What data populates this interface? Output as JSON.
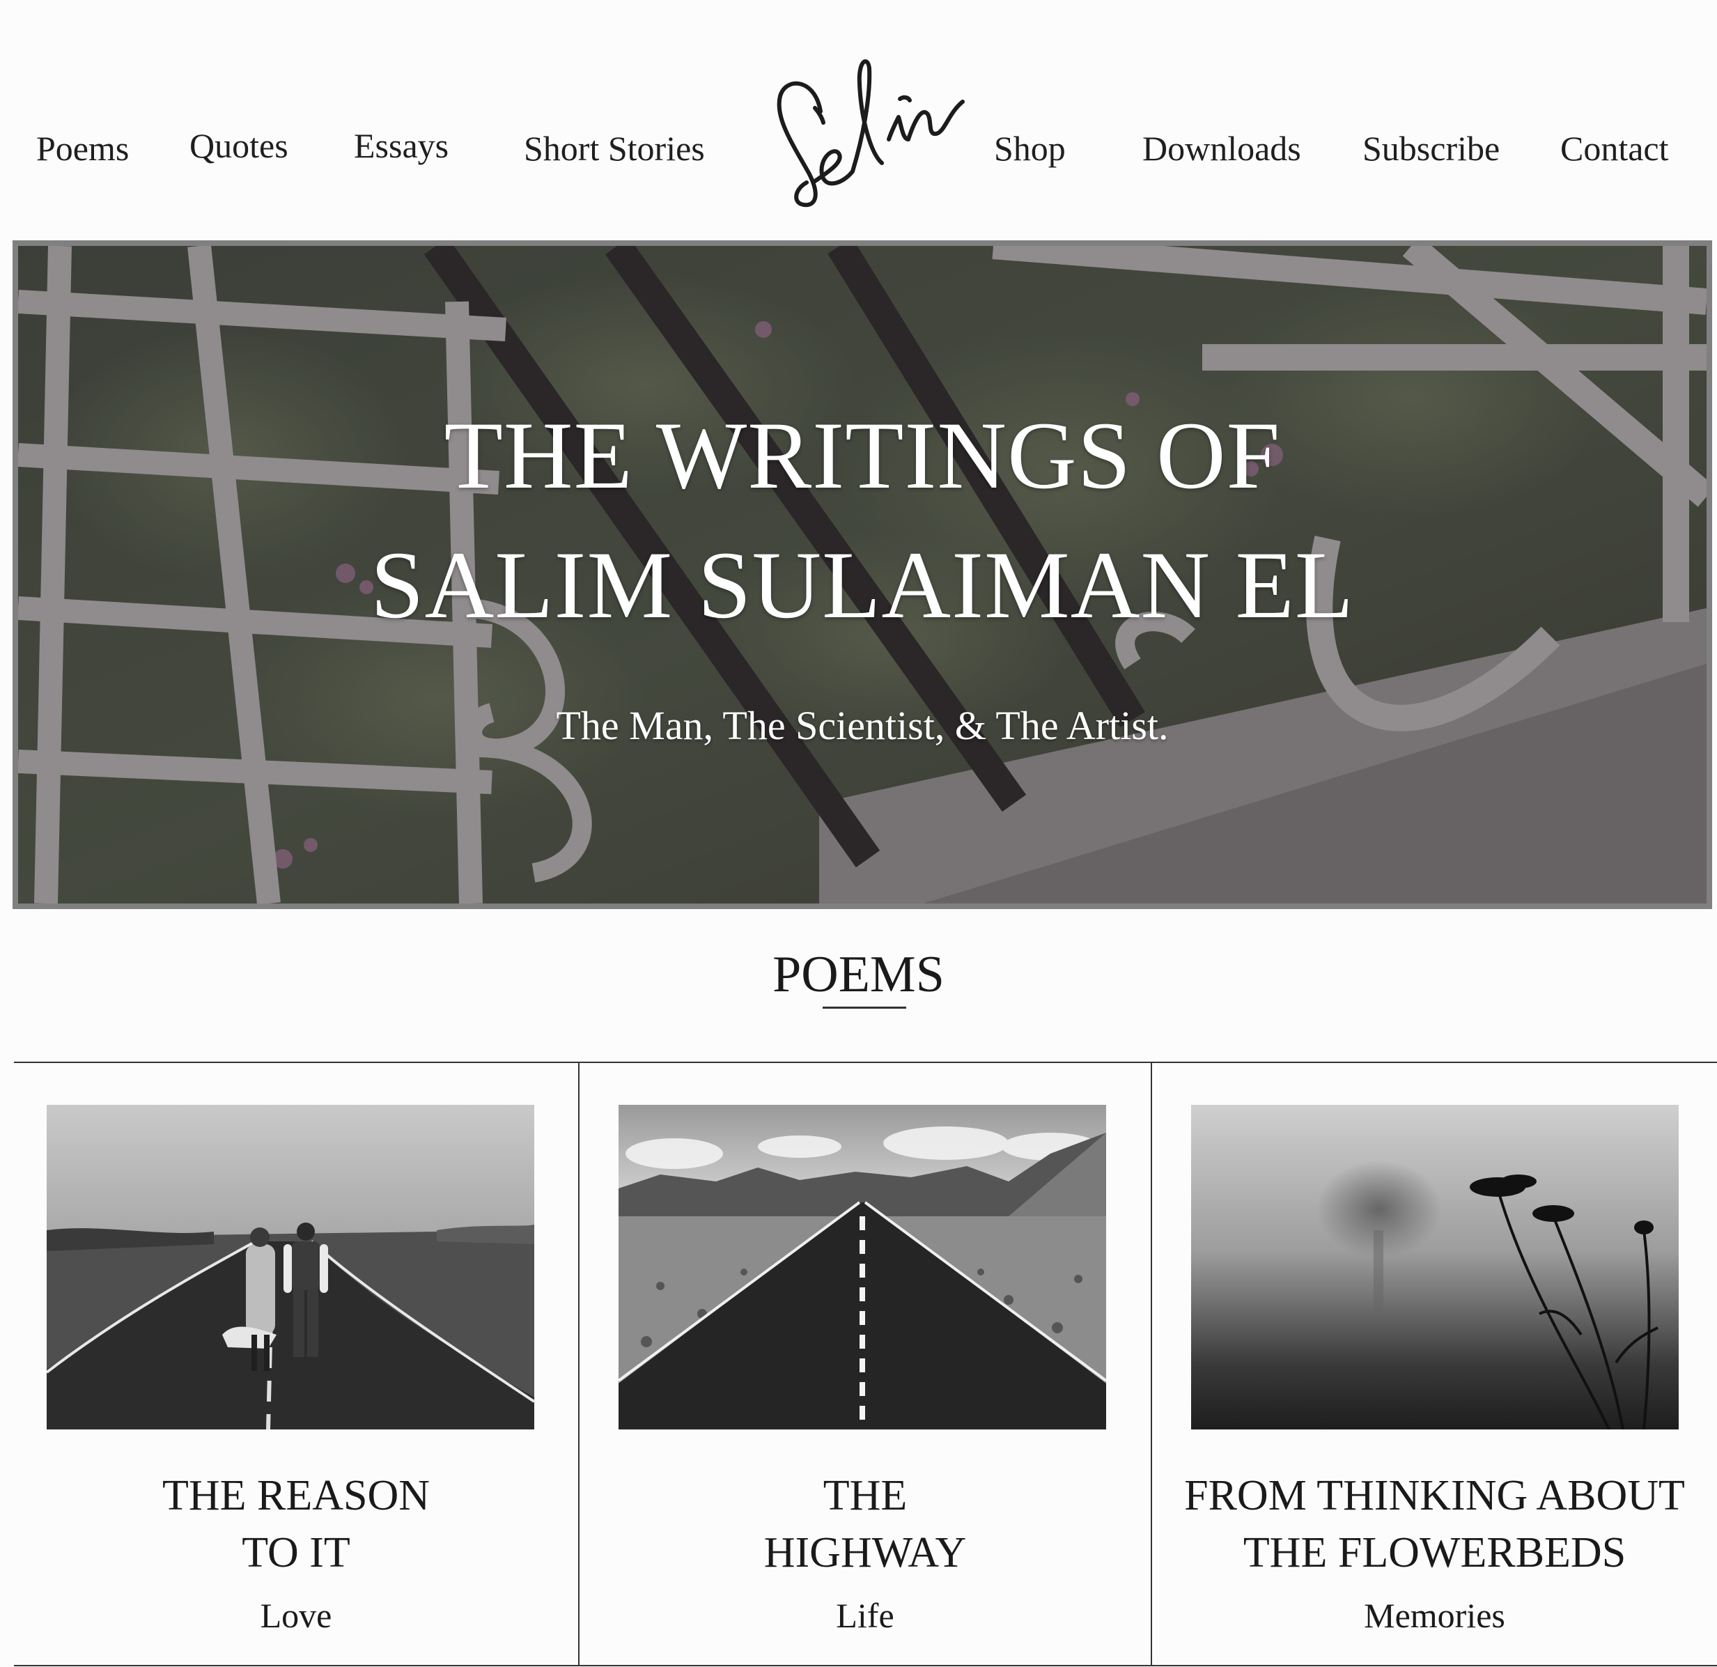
{
  "nav": {
    "left": [
      "Poems",
      "Quotes",
      "Essays",
      "Short Stories"
    ],
    "right": [
      "Shop",
      "Downloads",
      "Subscribe",
      "Contact"
    ]
  },
  "logo": {
    "kind": "handwritten-signature"
  },
  "hero": {
    "title_line_1": "THE WRITINGS OF",
    "title_line_2": "SALIM SULAIMAN EL",
    "subtitle": "The Man, The Scientist, & The Artist."
  },
  "section": {
    "heading": "POEMS"
  },
  "poems": [
    {
      "title_lines": [
        "THE REASON",
        "TO IT"
      ],
      "category": "Love"
    },
    {
      "title_lines": [
        "THE",
        "HIGHWAY"
      ],
      "category": "Life"
    },
    {
      "title_lines": [
        "FROM THINKING ABOUT",
        "THE FLOWERBEDS"
      ],
      "category": "Memories"
    }
  ],
  "colors": {
    "background": "#fcfcfc",
    "text": "#1a1a1a",
    "hero_border": "#808080",
    "rule": "#333333"
  }
}
